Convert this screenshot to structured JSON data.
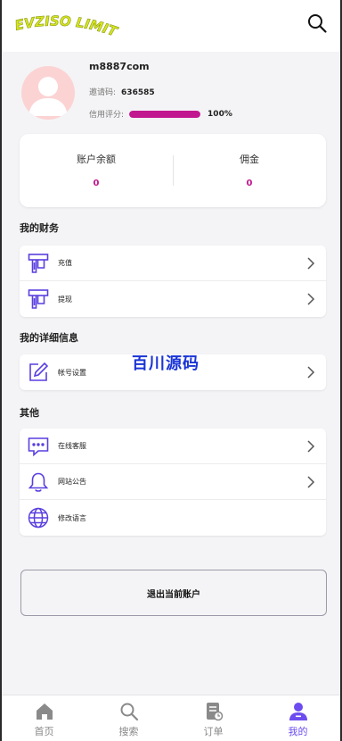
{
  "brand": {
    "logo_text": "EVZISO LIMITED",
    "logo_color": "#c9d81a"
  },
  "profile": {
    "username": "m8887com",
    "invite_label": "邀请码:",
    "invite_code": "636585",
    "credit_label": "信用评分:",
    "credit_value": "100%",
    "credit_fraction": 1.0
  },
  "balance": {
    "account_label": "账户余额",
    "account_value": "0",
    "commission_label": "佣金",
    "commission_value": "0"
  },
  "sections": {
    "finance_title": "我的财务",
    "finance_items": [
      {
        "label": "充值",
        "icon": "atm-deposit-icon"
      },
      {
        "label": "提现",
        "icon": "atm-withdraw-icon"
      }
    ],
    "details_title": "我的详细信息",
    "details_items": [
      {
        "label": "帐号设置",
        "icon": "edit-icon"
      }
    ],
    "other_title": "其他",
    "other_items": [
      {
        "label": "在线客服",
        "icon": "chat-icon"
      },
      {
        "label": "网站公告",
        "icon": "bell-icon"
      },
      {
        "label": "修改语言",
        "icon": "globe-icon"
      }
    ]
  },
  "watermark": "百川源码",
  "logout_label": "退出当前账户",
  "tabbar": {
    "items": [
      {
        "label": "首页",
        "icon": "home-icon"
      },
      {
        "label": "搜索",
        "icon": "search-icon"
      },
      {
        "label": "订单",
        "icon": "order-icon"
      },
      {
        "label": "我的",
        "icon": "user-icon"
      }
    ]
  },
  "colors": {
    "accent": "#6c4cf0",
    "credit": "#c2188f",
    "icon": "#5a3fe0"
  }
}
